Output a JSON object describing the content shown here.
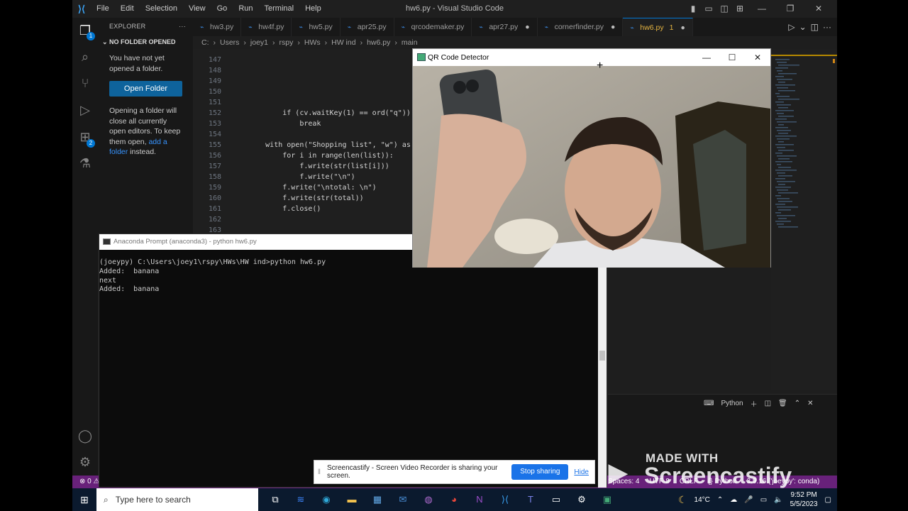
{
  "window": {
    "title": "hw6.py - Visual Studio Code",
    "menu": [
      "File",
      "Edit",
      "Selection",
      "View",
      "Go",
      "Run",
      "Terminal",
      "Help"
    ]
  },
  "activity_badges": {
    "explorer": "1",
    "extensions": "2"
  },
  "sidebar": {
    "header": "EXPLORER",
    "section": "NO FOLDER OPENED",
    "intro": "You have not yet opened a folder.",
    "open_button": "Open Folder",
    "note_before": "Opening a folder will close all currently open editors. To keep them open, ",
    "note_link": "add a folder",
    "note_after": " instead."
  },
  "tabs": [
    {
      "label": "hw3.py",
      "modified": false,
      "active": false
    },
    {
      "label": "hw4f.py",
      "modified": false,
      "active": false
    },
    {
      "label": "hw5.py",
      "modified": false,
      "active": false
    },
    {
      "label": "apr25.py",
      "modified": false,
      "active": false
    },
    {
      "label": "qrcodemaker.py",
      "modified": false,
      "active": false
    },
    {
      "label": "apr27.py",
      "modified": true,
      "active": false
    },
    {
      "label": "cornerfinder.py",
      "modified": true,
      "active": false
    },
    {
      "label": "hw6.py",
      "modified": true,
      "active": true,
      "problems": "1"
    }
  ],
  "breadcrumb": [
    "C:",
    "Users",
    "joey1",
    "rspy",
    "HWs",
    "HW ind",
    "hw6.py",
    "main"
  ],
  "code_lines": [
    {
      "n": "147",
      "text": ""
    },
    {
      "n": "148",
      "text": ""
    },
    {
      "n": "149",
      "text": ""
    },
    {
      "n": "150",
      "text": ""
    },
    {
      "n": "151",
      "text": ""
    },
    {
      "n": "152",
      "text": "            if (cv.waitKey(1) == ord(\"q\")):"
    },
    {
      "n": "153",
      "text": "                break"
    },
    {
      "n": "154",
      "text": ""
    },
    {
      "n": "155",
      "text": "        with open(\"Shopping list\", \"w\") as f:"
    },
    {
      "n": "156",
      "text": "            for i in range(len(list)):"
    },
    {
      "n": "157",
      "text": "                f.write(str(list[i]))"
    },
    {
      "n": "158",
      "text": "                f.write(\"\\n\")"
    },
    {
      "n": "159",
      "text": "            f.write(\"\\ntotal: \\n\")"
    },
    {
      "n": "160",
      "text": "            f.write(str(total))"
    },
    {
      "n": "161",
      "text": "            f.close()"
    },
    {
      "n": "162",
      "text": ""
    },
    {
      "n": "163",
      "text": ""
    }
  ],
  "prompt": {
    "title": "Anaconda Prompt (anaconda3) - python  hw6.py",
    "output": "(joeypy) C:\\Users\\joey1\\rspy\\HWs\\HW ind>python hw6.py\nAdded:  banana\nnext\nAdded:  banana"
  },
  "qr_window": {
    "title": "QR Code Detector"
  },
  "terminal_panel": {
    "label": "Python"
  },
  "statusbar": {
    "left": "⊗ 0 ⚠",
    "right": [
      "Spaces: 4",
      "UTF-8",
      "CRLF",
      "{} Python",
      "3.9.16 ('joeypy': conda)"
    ]
  },
  "screencastify": {
    "message": "Screencastify - Screen Video Recorder is sharing your screen.",
    "stop": "Stop sharing",
    "hide": "Hide",
    "watermark_top": "MADE WITH",
    "watermark_brand": "Screencastify"
  },
  "taskbar": {
    "search_placeholder": "Type here to search",
    "weather": "14°C",
    "time": "9:52 PM",
    "date": "5/5/2023"
  }
}
